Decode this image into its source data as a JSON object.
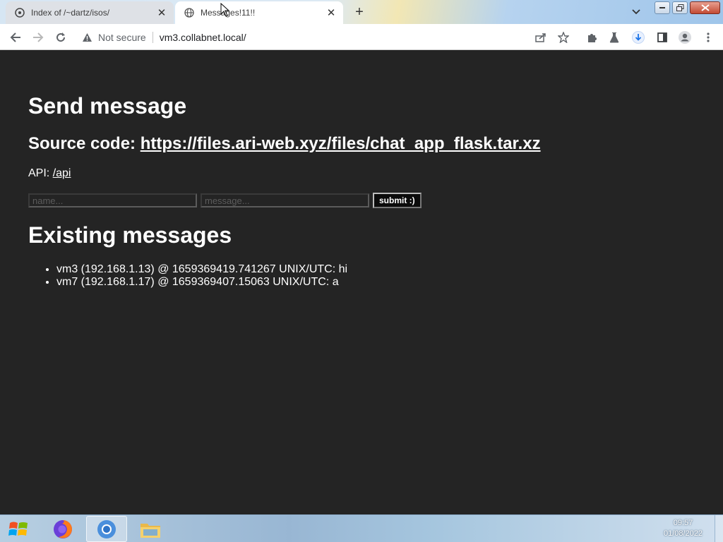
{
  "browser": {
    "tabs": [
      {
        "title": "Index of /~dartz/isos/",
        "active": false
      },
      {
        "title": "Messages!11!!",
        "active": true
      }
    ],
    "address": {
      "security_label": "Not secure",
      "url": "vm3.collabnet.local/"
    }
  },
  "page": {
    "heading_send": "Send message",
    "source_label": "Source code: ",
    "source_link": "https://files.ari-web.xyz/files/chat_app_flask.tar.xz",
    "api_label": "API: ",
    "api_link": "/api",
    "form": {
      "name_placeholder": "name...",
      "message_placeholder": "message...",
      "submit_label": "submit :)"
    },
    "heading_existing": "Existing messages",
    "messages": [
      "vm3 (192.168.1.13) @ 1659369419.741267 UNIX/UTC: hi",
      "vm7 (192.168.1.17) @ 1659369407.15063 UNIX/UTC: a"
    ]
  },
  "taskbar": {
    "time": "09:57",
    "date": "01/08/2022",
    "apps": [
      "firefox-icon",
      "chrome-icon",
      "file-explorer-icon"
    ]
  }
}
